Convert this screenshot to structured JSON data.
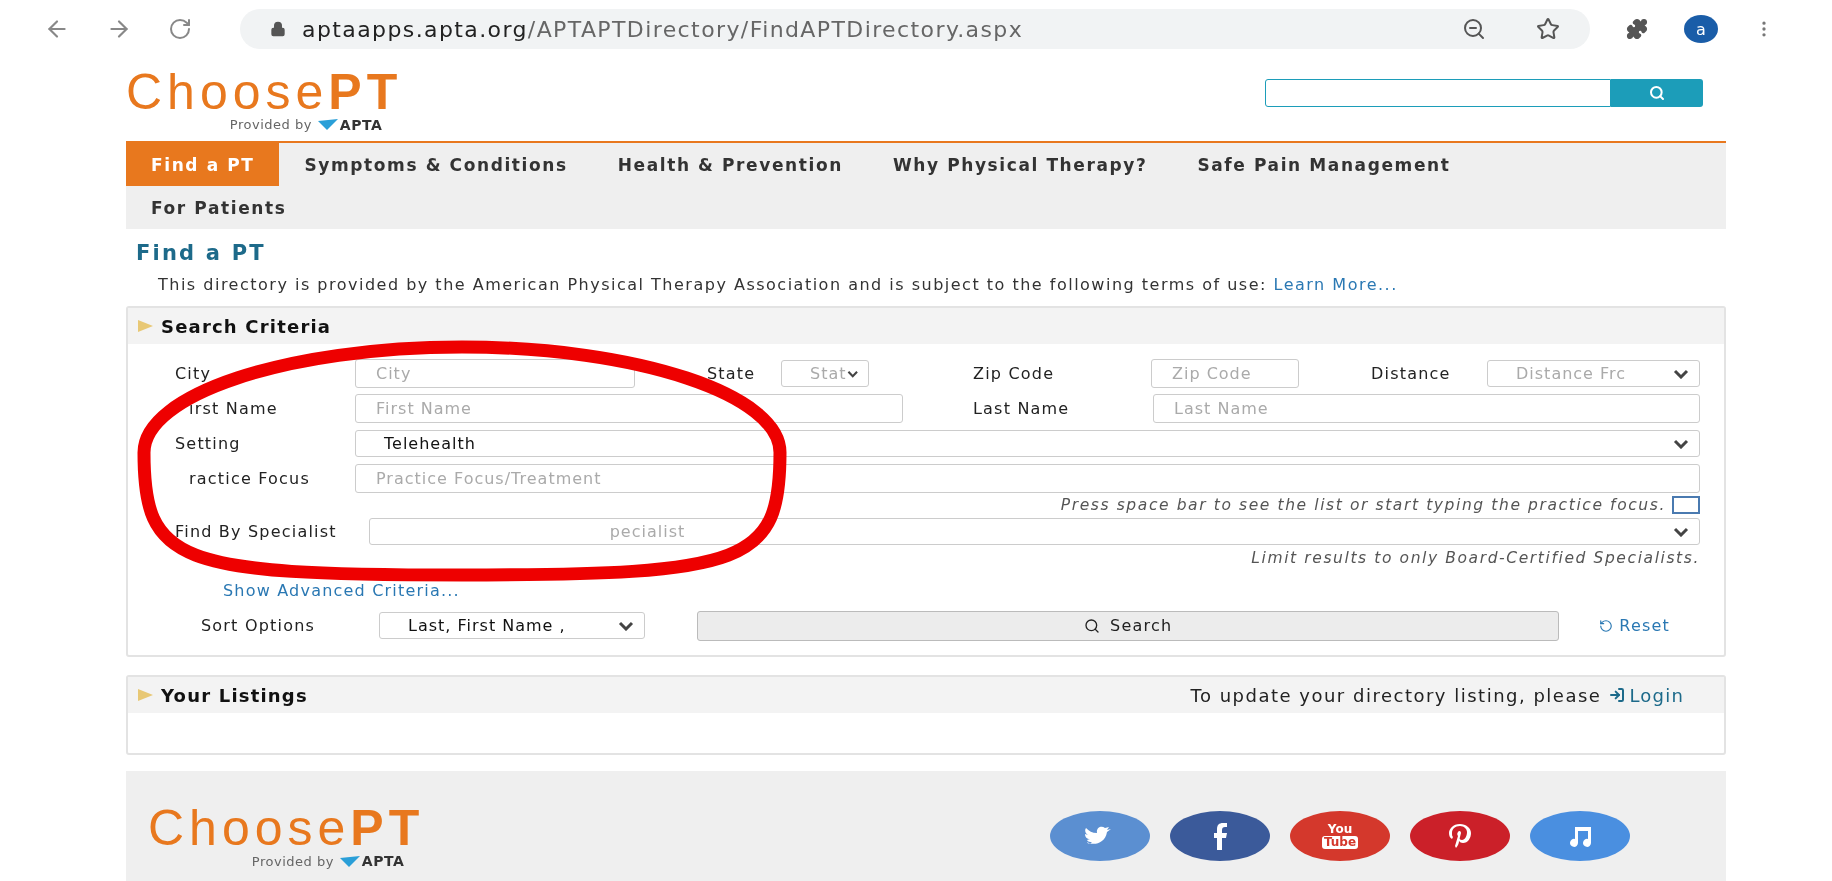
{
  "browser": {
    "url_host": "aptaapps.apta.org",
    "url_path": "/APTAPTDirectory/FindAPTDirectory.aspx",
    "avatar": "a"
  },
  "header": {
    "logo": {
      "choose": "Choose",
      "pt": "PT",
      "provided_by": "Provided by",
      "apta": "APTA"
    }
  },
  "nav": [
    {
      "label": "Find a PT",
      "selected": true
    },
    {
      "label": "Symptoms & Conditions",
      "selected": false
    },
    {
      "label": "Health & Prevention",
      "selected": false
    },
    {
      "label": "Why Physical Therapy?",
      "selected": false
    },
    {
      "label": "Safe Pain Management",
      "selected": false
    },
    {
      "label": "For Patients",
      "selected": false
    }
  ],
  "page_title": "Find a PT",
  "description": "This directory is provided by the American Physical Therapy Association and is subject to the following terms of use:",
  "learn_more": "Learn More...",
  "search_criteria": {
    "title": "Search Criteria",
    "city": {
      "label": "City",
      "placeholder": "City"
    },
    "state": {
      "label": "State",
      "placeholder": "Stat"
    },
    "zip": {
      "label": "Zip Code",
      "placeholder": "Zip Code"
    },
    "distance": {
      "label": "Distance",
      "placeholder": "Distance Frc"
    },
    "first_name": {
      "label": "irst Name",
      "placeholder": "First Name"
    },
    "last_name": {
      "label": "Last Name",
      "placeholder": "Last Name"
    },
    "setting": {
      "label": "Setting",
      "value": "Telehealth"
    },
    "practice_focus": {
      "label": "ractice Focus",
      "placeholder": "Practice Focus/Treatment"
    },
    "practice_hint": "Press space bar to see the list or start typing the practice focus.",
    "practice_hint_checked": false,
    "specialist": {
      "label": "Find By Specialist",
      "placeholder": "pecialist"
    },
    "specialist_hint": "Limit results to only Board-Certified Specialists.",
    "advanced_link": "Show Advanced Criteria...",
    "sort": {
      "label": "Sort Options",
      "value": "Last, First Name ,"
    },
    "search_button": "Search",
    "reset_button": "Reset"
  },
  "listings": {
    "title": "Your Listings",
    "note": "To update your directory listing, please",
    "login": "Login"
  },
  "footer": {
    "logo": {
      "choose": "Choose",
      "pt": "PT",
      "provided_by": "Provided by",
      "apta": "APTA"
    },
    "social": [
      {
        "kind": "twitter",
        "color": "#5b8fd1"
      },
      {
        "kind": "facebook",
        "color": "#3b5a9a"
      },
      {
        "kind": "youtube",
        "color": "#d4382c",
        "label_top": "You",
        "label_bottom": "Tube"
      },
      {
        "kind": "pinterest",
        "color": "#cb2029"
      },
      {
        "kind": "music",
        "color": "#4a8fe0"
      }
    ]
  }
}
